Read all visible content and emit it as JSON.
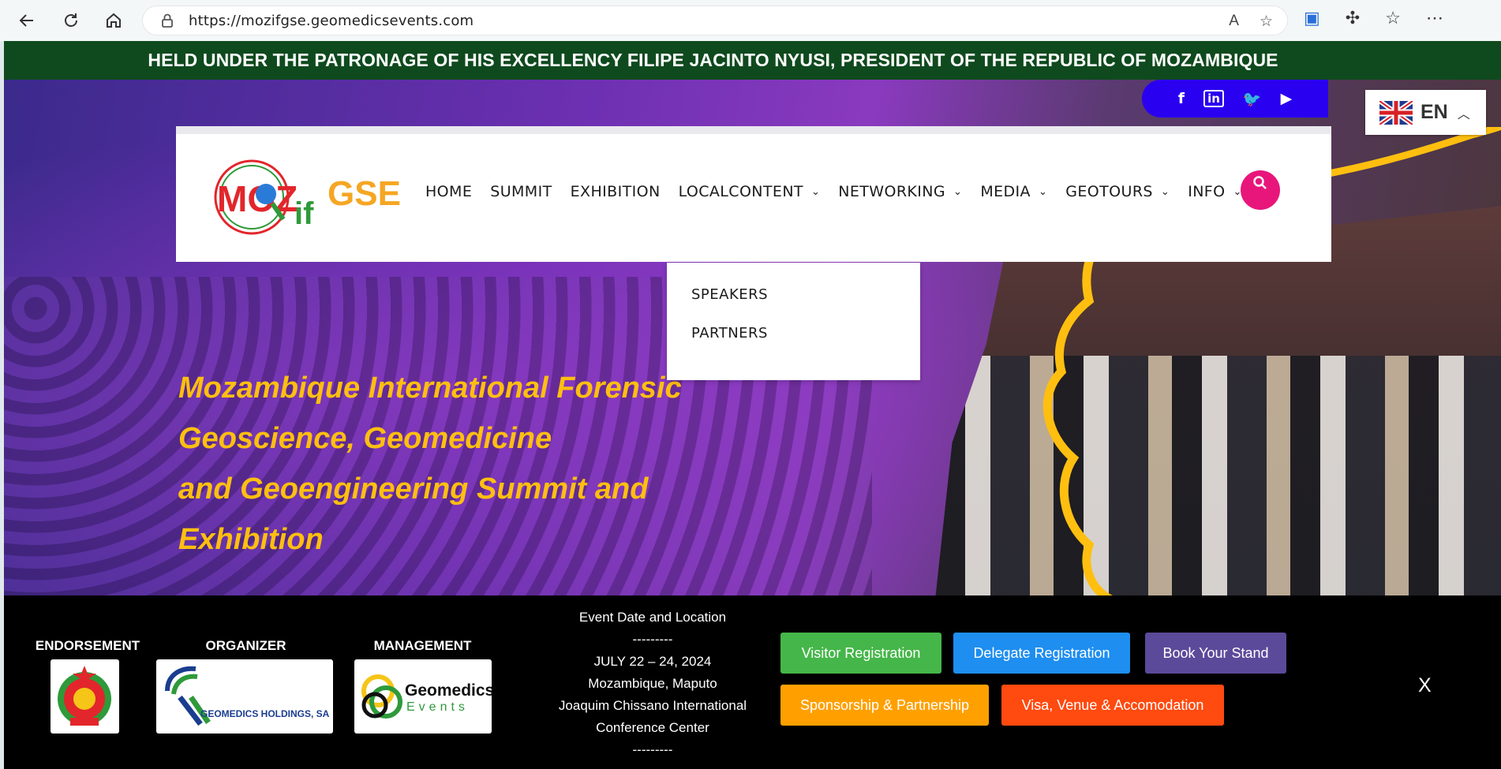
{
  "browser": {
    "url": "https://mozifgse.geomedicsevents.com"
  },
  "banner": {
    "patronage": "HELD UNDER THE PATRONAGE OF HIS EXCELLENCY FILIPE JACINTO NYUSI, PRESIDENT OF THE REPUBLIC OF MOZAMBIQUE"
  },
  "language": {
    "code": "EN"
  },
  "social": [
    "f",
    "in",
    "twitter",
    "youtube"
  ],
  "logo": {
    "part1": "MOZ",
    "part2": "if",
    "part3": "GSE"
  },
  "nav": {
    "items": [
      {
        "label": "HOME",
        "has_dropdown": false
      },
      {
        "label": "SUMMIT",
        "has_dropdown": false
      },
      {
        "label": "EXHIBITION",
        "has_dropdown": false
      },
      {
        "label": "LOCALCONTENT",
        "has_dropdown": true
      },
      {
        "label": "NETWORKING",
        "has_dropdown": true
      },
      {
        "label": "MEDIA",
        "has_dropdown": true
      },
      {
        "label": "GEOTOURS",
        "has_dropdown": true
      },
      {
        "label": "INFO",
        "has_dropdown": true
      }
    ],
    "dropdown": [
      "SPEAKERS",
      "PARTNERS"
    ]
  },
  "hero": {
    "lines": [
      "Mozambique International Forensic",
      "Geoscience, Geomedicine",
      "and Geoengineering Summit and",
      "Exhibition"
    ]
  },
  "infobar": {
    "endorsement_title": "ENDORSEMENT",
    "organizer_title": "ORGANIZER",
    "organizer_logo_text": "GEOMEDICS HOLDINGS, SA",
    "management_title": "MANAGEMENT",
    "management_logo_line1": "Geomedics",
    "management_logo_line2": "Events",
    "event": {
      "title": "Event Date and Location",
      "sep": "---------",
      "date": "JULY 22 – 24, 2024",
      "city": "Mozambique, Maputo",
      "venue1": "Joaquim Chissano International",
      "venue2": "Conference Center"
    },
    "buttons": {
      "visitor": "Visitor Registration",
      "delegate": "Delegate Registration",
      "stand": "Book Your Stand",
      "sponsorship": "Sponsorship & Partnership",
      "visa": "Visa, Venue & Accomodation"
    },
    "close": "X"
  },
  "colors": {
    "patronage_bg": "#0f4a1e",
    "accent_yellow": "#ffbf10",
    "search_pink": "#e8167b",
    "social_blue": "#2a00f0",
    "btn_green": "#45b649",
    "btn_blue": "#1e8ef0",
    "btn_purple": "#5b4a9a",
    "btn_orange": "#ffa000",
    "btn_red": "#ff4a10"
  }
}
